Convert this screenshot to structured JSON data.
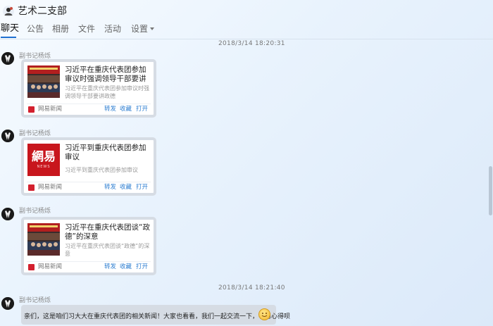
{
  "header": {
    "title": "艺术二支部",
    "group_icon": "group-avatar-icon"
  },
  "tabs": [
    {
      "label": "聊天",
      "active": true
    },
    {
      "label": "公告"
    },
    {
      "label": "相册"
    },
    {
      "label": "文件"
    },
    {
      "label": "活动"
    },
    {
      "label": "设置"
    }
  ],
  "messages": [
    {
      "timestamp": "2018/3/14 18:20:31"
    },
    {
      "sender": "副书记杨烁",
      "card": {
        "title": "习近平在重庆代表团参加审议时强调领导干部要讲政德",
        "desc": "习近平在重庆代表团参加审议时强调领导干部要讲政德",
        "source": "网易新闻",
        "actions": [
          "转发",
          "收藏",
          "打开"
        ]
      }
    },
    {
      "sender": "副书记杨烁",
      "card": {
        "title": "习近平到重庆代表团参加审议",
        "desc": "习近平到重庆代表团参加审议",
        "source": "网易新闻",
        "thumb_text": "網易",
        "thumb_sub": "NEWS",
        "actions": [
          "转发",
          "收藏",
          "打开"
        ]
      }
    },
    {
      "sender": "副书记杨烁",
      "card": {
        "title": "习近平在重庆代表团谈“政德”的深意",
        "desc": "习近平在重庆代表团谈“政德”的深意",
        "source": "网易新闻",
        "actions": [
          "转发",
          "收藏",
          "打开"
        ]
      }
    },
    {
      "timestamp": "2018/3/14 18:21:40"
    },
    {
      "sender": "副书记杨烁",
      "text": "亲们，这是咱们习大大在重庆代表团的相关新闻！大家也看看，我们一起交流一下，学习心得呗",
      "emoji": "smile-emoji-icon"
    }
  ],
  "colors": {
    "accent": "#1e6fd0",
    "link": "#2a7cd0",
    "bubble": "#d6dce4",
    "news_red": "#d3202e"
  }
}
